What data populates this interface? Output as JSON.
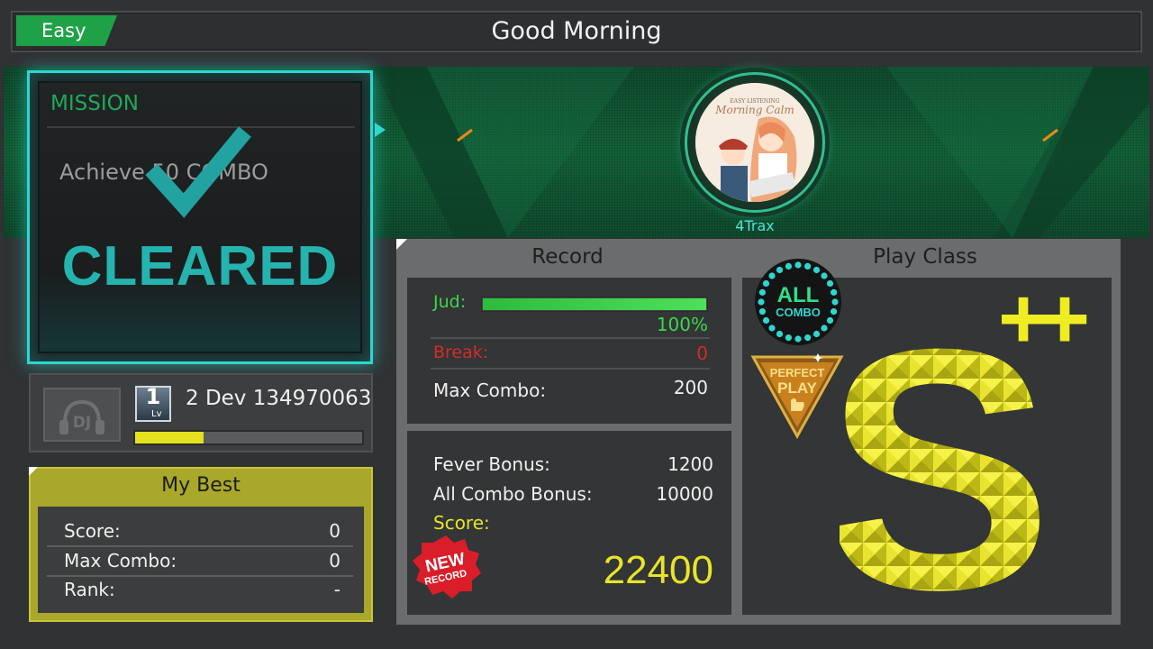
{
  "header": {
    "difficulty": "Easy",
    "song_title": "Good Morning"
  },
  "jacket": {
    "label": "4Trax",
    "art_subtitle": "EASY LISTENING",
    "art_title": "Morning Calm"
  },
  "mission": {
    "heading": "MISSION",
    "objective": "Achieve 50 COMBO",
    "status": "CLEARED"
  },
  "player": {
    "avatar_label": "DJ",
    "level": "1",
    "level_tag": "Lv",
    "name": "2 Dev 134970063",
    "exp_progress": 0.3
  },
  "my_best": {
    "title": "My Best",
    "rows": [
      {
        "label": "Score:",
        "value": "0"
      },
      {
        "label": "Max Combo:",
        "value": "0"
      },
      {
        "label": "Rank:",
        "value": "-"
      }
    ]
  },
  "record": {
    "title": "Record",
    "jud_label": "Jud:",
    "jud_percent": "100%",
    "jud_progress": 1.0,
    "break_label": "Break:",
    "break_value": "0",
    "max_combo_label": "Max Combo:",
    "max_combo_value": "200",
    "fever_bonus_label": "Fever Bonus:",
    "fever_bonus_value": "1200",
    "all_combo_bonus_label": "All Combo Bonus:",
    "all_combo_bonus_value": "10000",
    "score_label": "Score:",
    "score_value": "22400",
    "new_badge_top": "NEW",
    "new_badge_bottom": "RECORD"
  },
  "play_class": {
    "title": "Play Class",
    "all_combo_top": "ALL",
    "all_combo_bottom": "COMBO",
    "perfect_top": "PERFECT",
    "perfect_bottom": "PLAY",
    "grade": "S",
    "grade_suffix": "++"
  },
  "colors": {
    "accent_cyan": "#2fd6d0",
    "difficulty_green": "#1fa247",
    "judge_green": "#3cd64a",
    "break_red": "#d42a2a",
    "score_yellow": "#e8e42a",
    "grade_gold": "#e4e11e"
  }
}
